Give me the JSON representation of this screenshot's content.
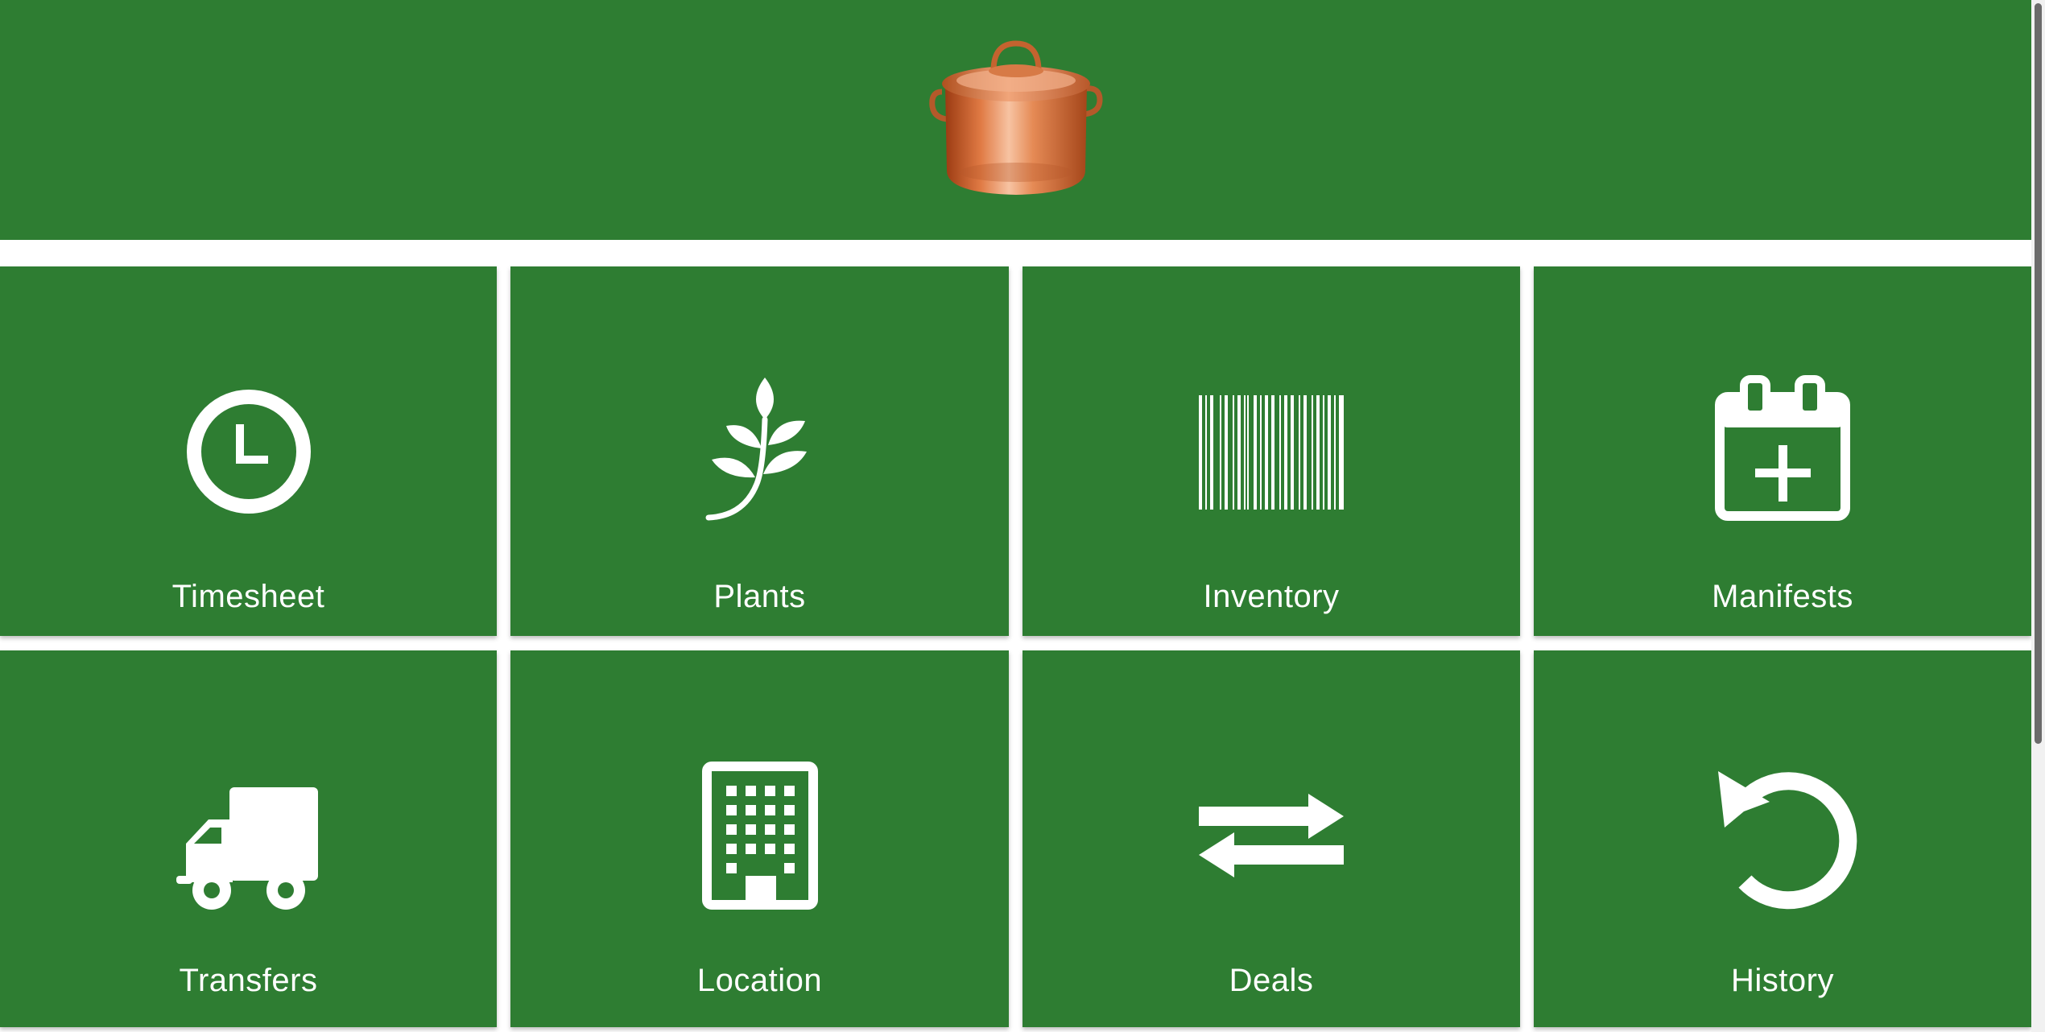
{
  "header": {
    "logo_icon": "copper-stock-pot-icon",
    "background_color": "#2e7d32"
  },
  "tiles": [
    {
      "label": "Timesheet",
      "icon": "clock-icon"
    },
    {
      "label": "Plants",
      "icon": "plant-sprig-icon"
    },
    {
      "label": "Inventory",
      "icon": "barcode-icon"
    },
    {
      "label": "Manifests",
      "icon": "calendar-plus-icon"
    },
    {
      "label": "Transfers",
      "icon": "truck-icon"
    },
    {
      "label": "Location",
      "icon": "building-icon"
    },
    {
      "label": "Deals",
      "icon": "swap-arrows-icon"
    },
    {
      "label": "History",
      "icon": "history-arrow-icon"
    }
  ],
  "colors": {
    "tile": "#2e7d32",
    "icon": "#ffffff",
    "text": "#ffffff",
    "pot": "#d2692f"
  }
}
